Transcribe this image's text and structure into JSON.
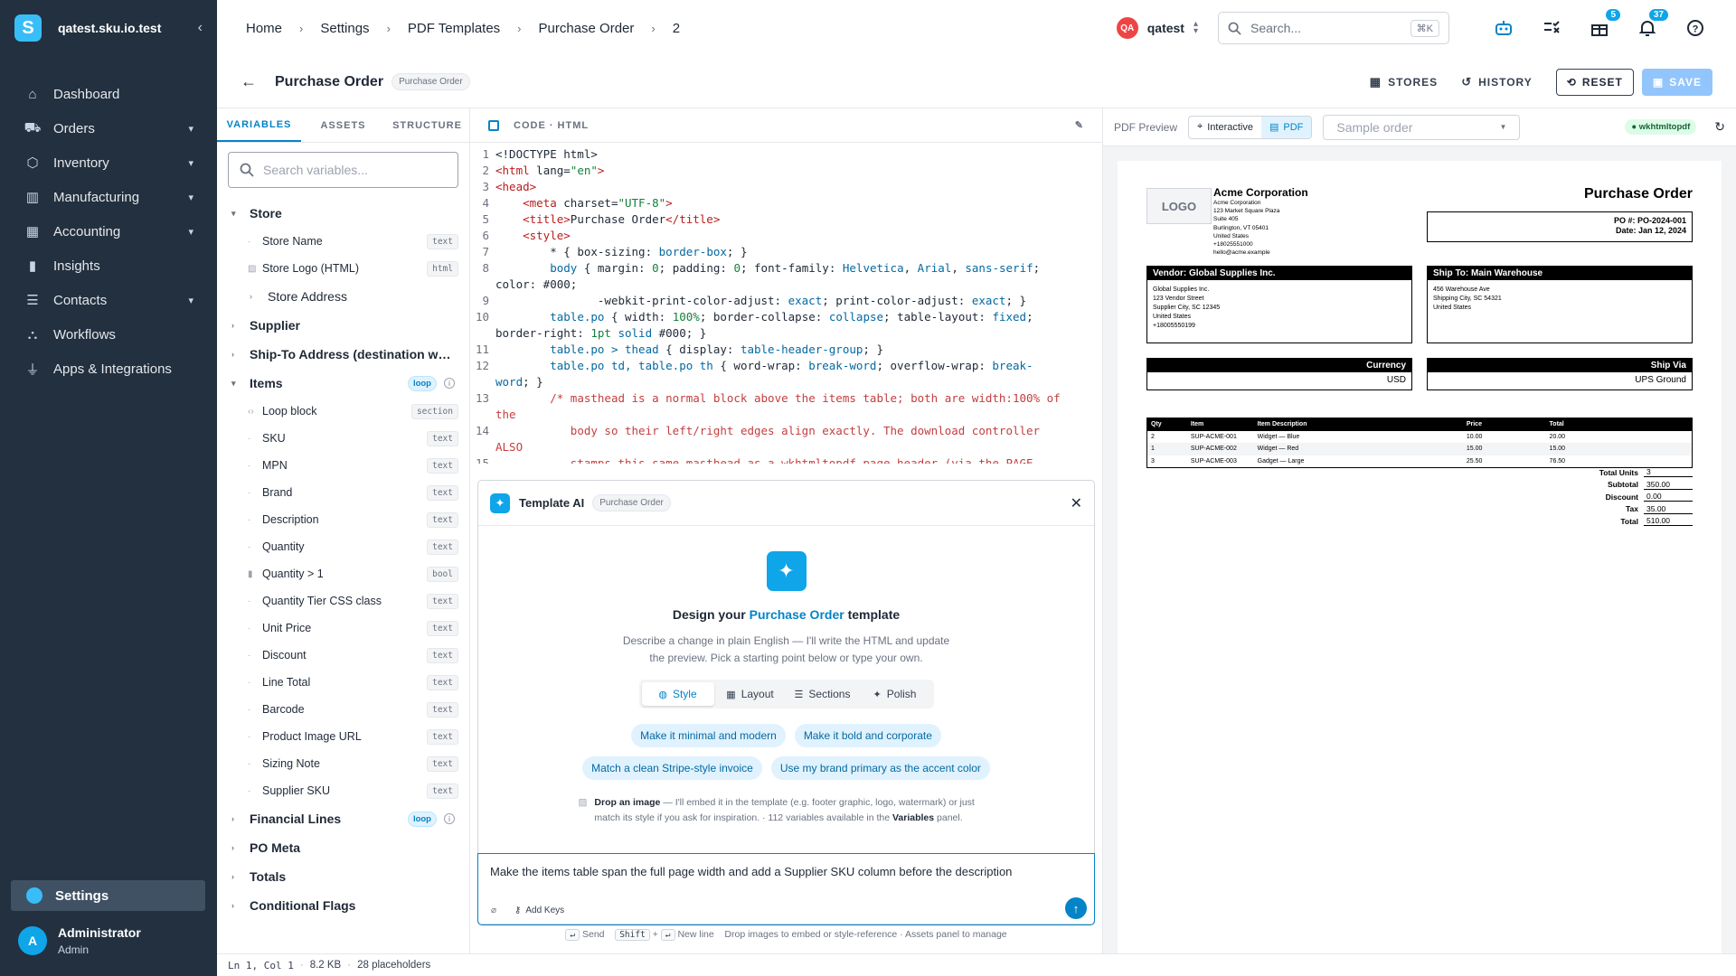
{
  "sidebar": {
    "logo_letter": "S",
    "store_name": "qatest.sku.io.test",
    "items": [
      {
        "label": "Dashboard",
        "icon": "home-icon",
        "has_children": false
      },
      {
        "label": "Orders",
        "icon": "cart-icon",
        "has_children": true
      },
      {
        "label": "Inventory",
        "icon": "box-icon",
        "has_children": true
      },
      {
        "label": "Manufacturing",
        "icon": "factory-icon",
        "has_children": true
      },
      {
        "label": "Accounting",
        "icon": "calculator-icon",
        "has_children": true
      },
      {
        "label": "Insights",
        "icon": "chart-icon",
        "has_children": false
      },
      {
        "label": "Contacts",
        "icon": "contacts-icon",
        "has_children": true
      },
      {
        "label": "Workflows",
        "icon": "workflow-icon",
        "has_children": false
      },
      {
        "label": "Apps & Integrations",
        "icon": "plug-icon",
        "has_children": false
      }
    ],
    "settings_label": "Settings",
    "user": {
      "initial": "A",
      "name": "Administrator",
      "role": "Admin"
    }
  },
  "topbar": {
    "breadcrumbs": [
      "Home",
      "Settings",
      "PDF Templates",
      "Purchase Order",
      "2"
    ],
    "user_badge": "QA",
    "user_name": "qatest",
    "search_placeholder": "Search...",
    "search_shortcut": "⌘K",
    "gift_badge": "5",
    "notification_badge": "37"
  },
  "page": {
    "title": "Purchase Order",
    "badge": "Purchase Order",
    "actions": {
      "stores": "STORES",
      "history": "HISTORY",
      "reset": "RESET",
      "save": "SAVE"
    }
  },
  "variables": {
    "tabs": [
      "VARIABLES",
      "ASSETS",
      "STRUCTURE"
    ],
    "search_placeholder": "Search variables...",
    "store_group": "Store",
    "store_items": [
      {
        "label": "Store Name",
        "type": "text"
      },
      {
        "label": "Store Logo (HTML)",
        "type": "html"
      }
    ],
    "store_address": "Store Address",
    "supplier": "Supplier",
    "ship_to": "Ship-To Address (destination warehouse)",
    "items_group": "Items",
    "items_badge": "loop",
    "item_vars": [
      {
        "label": "Loop block",
        "type": "section"
      },
      {
        "label": "SKU",
        "type": "text"
      },
      {
        "label": "MPN",
        "type": "text"
      },
      {
        "label": "Brand",
        "type": "text"
      },
      {
        "label": "Description",
        "type": "text"
      },
      {
        "label": "Quantity",
        "type": "text"
      },
      {
        "label": "Quantity > 1",
        "type": "bool"
      },
      {
        "label": "Quantity Tier CSS class",
        "type": "text"
      },
      {
        "label": "Unit Price",
        "type": "text"
      },
      {
        "label": "Discount",
        "type": "text"
      },
      {
        "label": "Line Total",
        "type": "text"
      },
      {
        "label": "Barcode",
        "type": "text"
      },
      {
        "label": "Product Image URL",
        "type": "text"
      },
      {
        "label": "Sizing Note",
        "type": "text"
      },
      {
        "label": "Supplier SKU",
        "type": "text"
      }
    ],
    "financial_lines": "Financial Lines",
    "financial_badge": "loop",
    "po_meta": "PO Meta",
    "totals": "Totals",
    "conditional_flags": "Conditional Flags"
  },
  "code": {
    "header": "CODE · HTML",
    "lines": [
      {
        "n": "1",
        "html": "&lt;!DOCTYPE html&gt;"
      },
      {
        "n": "2",
        "html": "<span class='c-tag'>&lt;html</span> lang=<span class='c-str'>\"en\"</span><span class='c-tag'>&gt;</span>"
      },
      {
        "n": "3",
        "html": "<span class='c-tag'>&lt;head&gt;</span>"
      },
      {
        "n": "4",
        "html": "    <span class='c-tag'>&lt;meta</span> charset=<span class='c-str'>\"UTF-8\"</span><span class='c-tag'>&gt;</span>"
      },
      {
        "n": "5",
        "html": "    <span class='c-tag'>&lt;title&gt;</span>Purchase Order<span class='c-tag'>&lt;/title&gt;</span>"
      },
      {
        "n": "6",
        "html": "    <span class='c-tag'>&lt;style&gt;</span>"
      },
      {
        "n": "7",
        "html": "        * { box-sizing: <span class='c-kw'>border-box</span>; }"
      },
      {
        "n": "8",
        "html": "        <span class='c-kw'>body</span> { margin: <span class='c-str'>0</span>; padding: <span class='c-str'>0</span>; font-family: <span class='c-kw'>Helvetica</span>, <span class='c-kw'>Arial</span>, <span class='c-kw'>sans-serif</span>;\ncolor: #000;"
      },
      {
        "n": "9",
        "html": "               -webkit-print-color-adjust: <span class='c-kw'>exact</span>; print-color-adjust: <span class='c-kw'>exact</span>; }"
      },
      {
        "n": "10",
        "html": "        <span class='c-kw'>table.po</span> { width: <span class='c-str'>100%</span>; border-collapse: <span class='c-kw'>collapse</span>; table-layout: <span class='c-kw'>fixed</span>;\nborder-right: <span class='c-str'>1pt</span> <span class='c-kw'>solid</span> #000; }"
      },
      {
        "n": "11",
        "html": "        <span class='c-kw'>table.po &gt; thead</span> { display: <span class='c-kw'>table-header-group</span>; }"
      },
      {
        "n": "12",
        "html": "        <span class='c-kw'>table.po td, table.po th</span> { word-wrap: <span class='c-kw'>break-word</span>; overflow-wrap: <span class='c-kw'>break-\nword</span>; }"
      },
      {
        "n": "13",
        "html": "        <span class='c-com'>/* masthead is a normal block above the items table; both are width:100% of\nthe</span>"
      },
      {
        "n": "14",
        "html": "<span class='c-com'>           body so their left/right edges align exactly. The download controller\nALSO</span>"
      },
      {
        "n": "15",
        "html": "<span class='c-com'>           stamps this same masthead as a wkhtmltopdf page header (via the PAGE-</span>"
      }
    ]
  },
  "ai": {
    "title": "Template AI",
    "badge": "Purchase Order",
    "heading_pre": "Design your ",
    "heading_accent": "Purchase Order",
    "heading_post": " template",
    "description": "Describe a change in plain English — I'll write the HTML and update the preview. Pick a starting point below or type your own.",
    "segments": [
      {
        "label": "Style",
        "icon": "palette-icon",
        "active": true
      },
      {
        "label": "Layout",
        "icon": "layout-icon",
        "active": false
      },
      {
        "label": "Sections",
        "icon": "list-icon",
        "active": false
      },
      {
        "label": "Polish",
        "icon": "wand-icon",
        "active": false
      }
    ],
    "chips": [
      "Make it minimal and modern",
      "Make it bold and corporate",
      "Match a clean Stripe-style invoice",
      "Use my brand primary as the accent color"
    ],
    "drop_title": "Drop an image",
    "drop_text": " — I'll embed it in the template (e.g. footer graphic, logo, watermark) or just match its style if you ask for inspiration. · 112 variables available in the ",
    "drop_link": "Variables",
    "drop_end": " panel.",
    "prompt_value": "Make the items table span the full page width and add a Supplier SKU column before the description",
    "add_keys": "Add Keys",
    "hint_send_key": "↵",
    "hint_send": "Send",
    "hint_shift": "Shift",
    "hint_plus": "+",
    "hint_newline_key": "↵",
    "hint_newline": "New line",
    "hint_rest": "Drop images to embed or style-reference · Assets panel to manage"
  },
  "preview": {
    "title": "PDF Preview",
    "toggle": [
      "Interactive",
      "PDF"
    ],
    "sample_placeholder": "Sample order",
    "engine": "wkhtmltopdf",
    "doc": {
      "logo": "LOGO",
      "company": "Acme Corporation",
      "company_lines": [
        "Acme Corporation",
        "123 Market Square Plaza",
        "Suite 405",
        "Burlington, VT 05401",
        "United States",
        "+18025551000",
        "hello@acme.example"
      ],
      "title": "Purchase Order",
      "po_number": "PO #: PO-2024-001",
      "date": "Date: Jan 12, 2024",
      "vendor_header": "Vendor: Global Supplies Inc.",
      "vendor_lines": [
        "Global Supplies Inc.",
        "123 Vendor Street",
        "Supplier City, SC 12345",
        "United States",
        "+18005550199"
      ],
      "ship_header": "Ship To: Main Warehouse",
      "ship_lines": [
        "456 Warehouse Ave",
        "Shipping City, SC 54321",
        "United States"
      ],
      "currency_label": "Currency",
      "currency_value": "USD",
      "shipvia_label": "Ship Via",
      "shipvia_value": "UPS Ground",
      "columns": [
        "Qty",
        "Item",
        "Item Description",
        "Price",
        "Total"
      ],
      "rows": [
        [
          "2",
          "SUP-ACME-001",
          "Widget — Blue",
          "10.00",
          "20.00"
        ],
        [
          "1",
          "SUP-ACME-002",
          "Widget — Red",
          "15.00",
          "15.00"
        ],
        [
          "3",
          "SUP-ACME-003",
          "Gadget — Large",
          "25.50",
          "76.50"
        ]
      ],
      "totals": [
        [
          "Total Units",
          "3"
        ],
        [
          "Subtotal",
          "350.00"
        ],
        [
          "Discount",
          "0.00"
        ],
        [
          "Tax",
          "35.00"
        ],
        [
          "Total",
          "510.00"
        ]
      ]
    }
  },
  "status": {
    "position": "Ln 1, Col 1",
    "size": "8.2 KB",
    "placeholders": "28 placeholders"
  }
}
